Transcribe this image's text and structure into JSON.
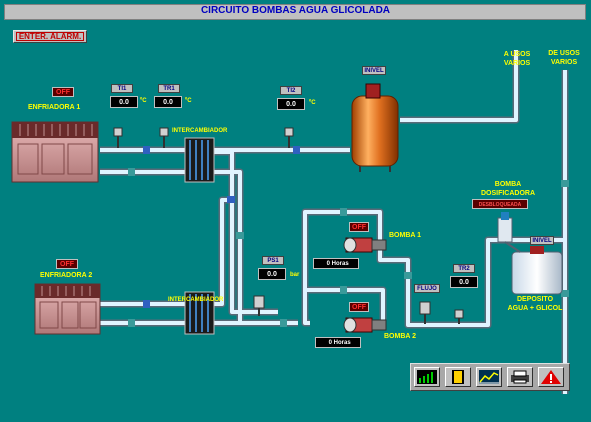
{
  "window": {
    "title": "CIRCUITO BOMBAS AGUA GLICOLADA"
  },
  "alarm_button": {
    "label": "ENTER. ALARM."
  },
  "chillers": [
    {
      "label": "ENFRIADORA 1",
      "status": "OFF"
    },
    {
      "label": "ENFRIADORA 2",
      "status": "OFF"
    }
  ],
  "exchangers": [
    {
      "label": "INTERCAMBIADOR"
    },
    {
      "label": "INTERCAMBIADOR"
    }
  ],
  "sensors": {
    "th1": {
      "tag": "TI1",
      "value": "0.0",
      "unit": "ºC"
    },
    "tr1": {
      "tag": "TR1",
      "value": "0.0",
      "unit": "ºC"
    },
    "ti2": {
      "tag": "TI2",
      "value": "0.0",
      "unit": "ºC"
    },
    "ps1": {
      "tag": "PS1",
      "value": "0.0",
      "unit": "bar"
    },
    "tr2": {
      "tag": "TR2",
      "value": "0.0"
    },
    "flujo": {
      "tag": "FLUJO"
    }
  },
  "tank": {
    "level_tag": "INIVEL"
  },
  "outlets": {
    "a_usos": "A USOS\nVARIOS",
    "de_usos": "DE USOS\nVARIOS"
  },
  "pumps": [
    {
      "label": "BOMBA 1",
      "status": "OFF",
      "hours": "0",
      "hours_unit": "Horas"
    },
    {
      "label": "BOMBA 2",
      "status": "OFF",
      "hours": "0",
      "hours_unit": "Horas"
    }
  ],
  "dosing": {
    "label": "BOMBA\nDOSIFICADORA",
    "status": "DESBLOQUEADA"
  },
  "deposit": {
    "level_tag": "INIVEL",
    "label": "DEPOSITO\nAGUA + GLICOL"
  },
  "toolbar": {
    "buttons": [
      "trend-icon",
      "door-icon",
      "graph-icon",
      "printer-icon",
      "alarm-icon"
    ]
  },
  "colors": {
    "background": "#008080",
    "pipe": "#d8f0ff",
    "value_alarm": "#ff3030",
    "label": "#ffff00"
  }
}
